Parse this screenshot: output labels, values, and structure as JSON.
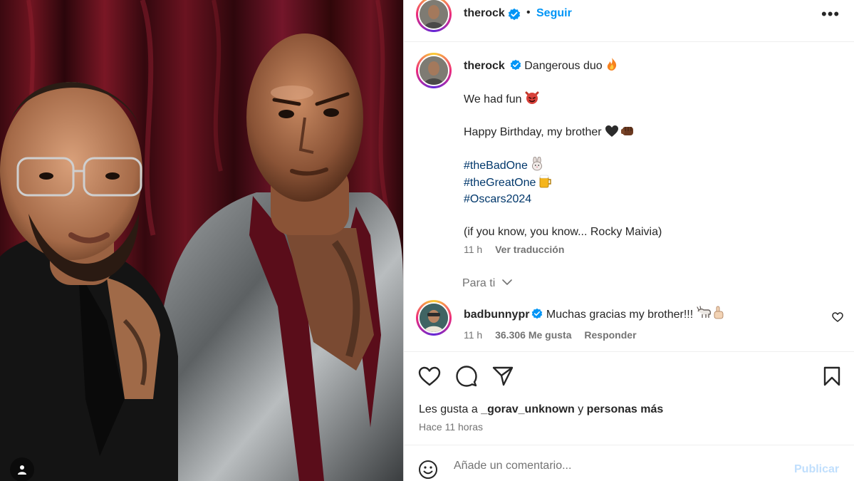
{
  "header": {
    "username": "therock",
    "separator": "•",
    "follow_label": "Seguir",
    "more_label": "•••"
  },
  "post": {
    "author": "therock",
    "caption_title": "Dangerous duo",
    "lines": {
      "line1": "We had fun",
      "line2": "Happy Birthday, my brother",
      "hashtag1": "#theBadOne",
      "hashtag2": "#theGreatOne",
      "hashtag3": "#Oscars2024",
      "line3": "(if you know, you know... Rocky Maivia)"
    },
    "emojis": [
      "fire",
      "smiling-devil",
      "black-heart",
      "fist-bump",
      "rabbit",
      "beer-mug"
    ],
    "time": "11 h",
    "translate_label": "Ver traducción"
  },
  "for_you": {
    "label": "Para ti"
  },
  "comment": {
    "username": "badbunnypr",
    "text": "Muchas gracias my brother!!!",
    "emojis": [
      "goat",
      "index-pointing-up"
    ],
    "time": "11 h",
    "likes": "36.306 Me gusta",
    "reply_label": "Responder"
  },
  "likes_summary": {
    "prefix": "Les gusta a",
    "user": "_gorav_unknown",
    "connector": "y",
    "others": "personas más"
  },
  "posted_ago": "Hace 11 horas",
  "comment_box": {
    "placeholder": "Añade un comentario...",
    "publish_label": "Publicar"
  },
  "colors": {
    "link_blue": "#0095f6",
    "hashtag_blue": "#00376b",
    "muted_text": "#737373",
    "publish_disabled": "#c0dffd",
    "verified_blue": "#0095f6"
  }
}
